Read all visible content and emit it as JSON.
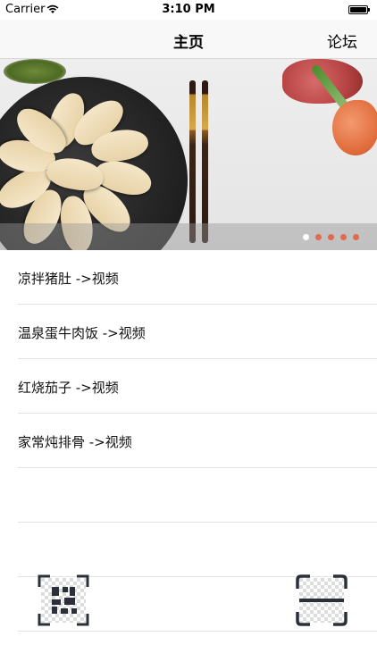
{
  "status_bar": {
    "carrier": "Carrier",
    "time": "3:10 PM",
    "battery_level": 1.0
  },
  "nav": {
    "title": "主页",
    "right_label": "论坛"
  },
  "banner": {
    "page_count": 5,
    "active_page": 0,
    "dot_color": "#e36a4e"
  },
  "list": {
    "items": [
      {
        "label": "凉拌猪肚 ->视频"
      },
      {
        "label": "温泉蛋牛肉饭 ->视频"
      },
      {
        "label": "红烧茄子 ->视频"
      },
      {
        "label": "家常炖排骨 ->视频"
      },
      {
        "label": ""
      },
      {
        "label": ""
      },
      {
        "label": ""
      }
    ]
  },
  "bottom": {
    "left_icon": "qr-code-icon",
    "right_icon": "scan-icon"
  }
}
